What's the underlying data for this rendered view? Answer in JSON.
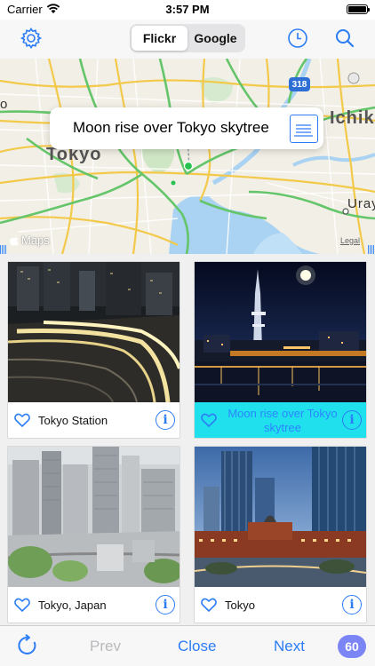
{
  "status_bar": {
    "carrier": "Carrier",
    "time": "3:57 PM"
  },
  "nav": {
    "segments": [
      "Flickr",
      "Google"
    ],
    "selected_segment": "Flickr",
    "icons": {
      "left": "settings-gear-icon",
      "history": "clock-icon",
      "search": "search-icon"
    },
    "accent_color": "#2b7cf5"
  },
  "map": {
    "place_labels": {
      "city": "Tokyo",
      "ichi": "Ichik",
      "uray": "Uray",
      "edge": "o"
    },
    "route_number": "318",
    "maps_brand": "Maps",
    "legal": "Legal",
    "callout": {
      "title": "Moon rise over Tokyo skytree",
      "button_icon": "list-detail-icon"
    }
  },
  "photos": [
    {
      "title": "Tokyo Station",
      "selected": false
    },
    {
      "title": "Moon rise over Tokyo skytree",
      "selected": true
    },
    {
      "title": "Tokyo, Japan",
      "selected": false
    },
    {
      "title": "Tokyo",
      "selected": false
    }
  ],
  "selected_color": "#20e0ee",
  "toolbar": {
    "prev_label": "Prev",
    "prev_enabled": false,
    "close_label": "Close",
    "next_label": "Next",
    "count": "60"
  }
}
